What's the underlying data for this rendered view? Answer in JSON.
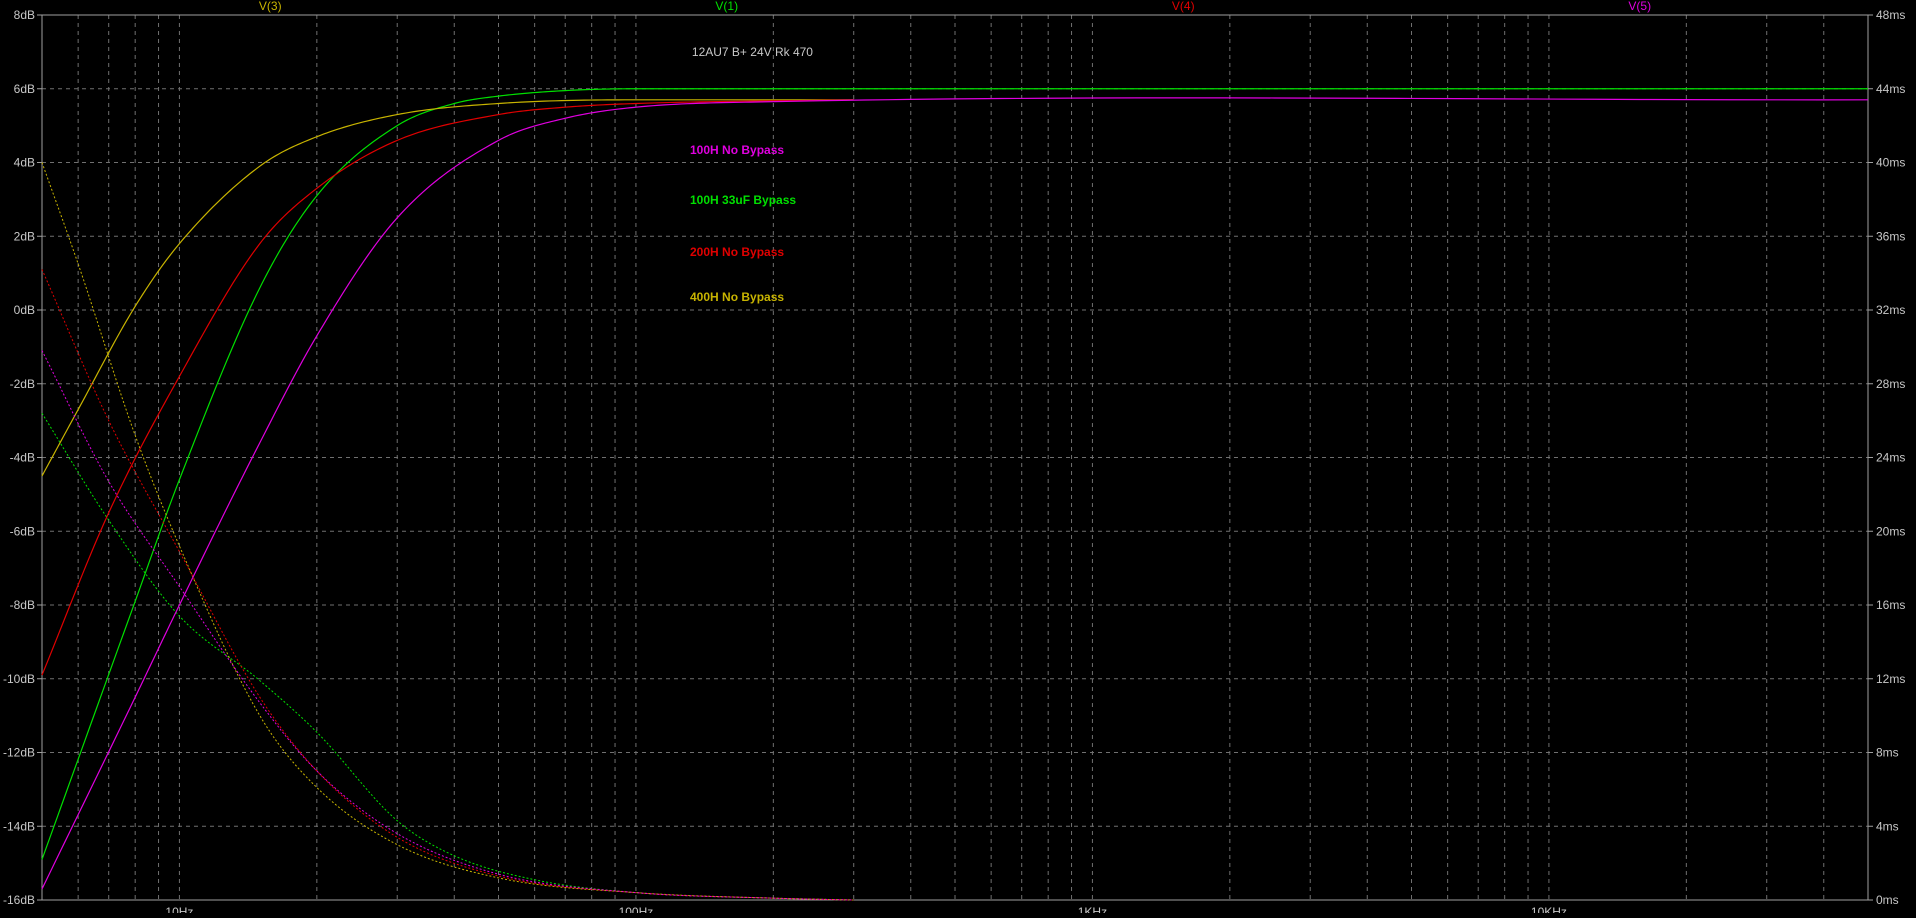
{
  "chart_data": {
    "type": "line",
    "title": "12AU7 B+ 24V Rk 470",
    "x_scale": "log",
    "xlim": [
      5,
      50000
    ],
    "y_left": {
      "unit": "dB",
      "ylim": [
        -16,
        8
      ],
      "ticks": [
        "8dB",
        "6dB",
        "4dB",
        "2dB",
        "0dB",
        "-2dB",
        "-4dB",
        "-6dB",
        "-8dB",
        "-10dB",
        "-12dB",
        "-14dB",
        "-16dB"
      ]
    },
    "y_right": {
      "unit": "ms",
      "ylim": [
        0,
        48
      ],
      "ticks": [
        "48ms",
        "44ms",
        "40ms",
        "36ms",
        "32ms",
        "28ms",
        "24ms",
        "20ms",
        "16ms",
        "12ms",
        "8ms",
        "4ms",
        "0ms"
      ]
    },
    "x_ticks": [
      {
        "value": 10,
        "label": "10Hz"
      },
      {
        "value": 100,
        "label": "100Hz"
      },
      {
        "value": 1000,
        "label": "1KHz"
      },
      {
        "value": 10000,
        "label": "10KHz"
      }
    ],
    "grid": true,
    "trace_headers": [
      {
        "label": "V(3)",
        "color": "#c8b400"
      },
      {
        "label": "V(1)",
        "color": "#00e000"
      },
      {
        "label": "V(4)",
        "color": "#e00000"
      },
      {
        "label": "V(5)",
        "color": "#e000e0"
      }
    ],
    "series": [
      {
        "name": "V(1)",
        "color": "#00e000",
        "magnitude_db": [
          [
            5,
            -14.9
          ],
          [
            8,
            -7.9
          ],
          [
            10,
            -4.6
          ],
          [
            15,
            0.6
          ],
          [
            20,
            3.1
          ],
          [
            30,
            5.0
          ],
          [
            40,
            5.6
          ],
          [
            50,
            5.8
          ],
          [
            70,
            5.95
          ],
          [
            100,
            6.0
          ],
          [
            300,
            6.0
          ],
          [
            50000,
            6.0
          ]
        ],
        "group_delay_ms": [
          [
            5,
            26.4
          ],
          [
            7,
            20.6
          ],
          [
            10,
            15.4
          ],
          [
            15,
            11.9
          ],
          [
            20,
            9.1
          ],
          [
            30,
            4.3
          ],
          [
            40,
            2.4
          ],
          [
            60,
            1.1
          ],
          [
            100,
            0.4
          ],
          [
            200,
            0.1
          ],
          [
            300,
            0.0
          ]
        ]
      },
      {
        "name": "V(3)",
        "color": "#c8b400",
        "magnitude_db": [
          [
            5,
            -4.5
          ],
          [
            6,
            -2.7
          ],
          [
            8,
            0.1
          ],
          [
            10,
            1.8
          ],
          [
            15,
            3.9
          ],
          [
            20,
            4.7
          ],
          [
            30,
            5.3
          ],
          [
            50,
            5.6
          ],
          [
            100,
            5.7
          ],
          [
            300,
            5.7
          ]
        ],
        "group_delay_ms": [
          [
            5,
            40.0
          ],
          [
            6,
            34.5
          ],
          [
            8,
            25.2
          ],
          [
            10,
            19.2
          ],
          [
            15,
            10.0
          ],
          [
            20,
            6.1
          ],
          [
            30,
            3.0
          ],
          [
            50,
            1.2
          ],
          [
            100,
            0.4
          ],
          [
            200,
            0.1
          ],
          [
            300,
            0.0
          ]
        ]
      },
      {
        "name": "V(4)",
        "color": "#e00000",
        "magnitude_db": [
          [
            5,
            -9.9
          ],
          [
            7,
            -5.5
          ],
          [
            10,
            -1.8
          ],
          [
            15,
            1.8
          ],
          [
            20,
            3.3
          ],
          [
            30,
            4.6
          ],
          [
            50,
            5.3
          ],
          [
            70,
            5.5
          ],
          [
            100,
            5.6
          ],
          [
            300,
            5.7
          ]
        ],
        "group_delay_ms": [
          [
            5,
            34.2
          ],
          [
            7,
            26.0
          ],
          [
            10,
            18.9
          ],
          [
            15,
            11.0
          ],
          [
            20,
            7.0
          ],
          [
            30,
            3.4
          ],
          [
            50,
            1.3
          ],
          [
            100,
            0.4
          ],
          [
            200,
            0.1
          ],
          [
            300,
            0.0
          ]
        ]
      },
      {
        "name": "V(5)",
        "color": "#e000e0",
        "magnitude_db": [
          [
            5,
            -15.7
          ],
          [
            8,
            -10.5
          ],
          [
            10,
            -8.0
          ],
          [
            15,
            -3.6
          ],
          [
            20,
            -0.7
          ],
          [
            30,
            2.5
          ],
          [
            50,
            4.6
          ],
          [
            70,
            5.2
          ],
          [
            100,
            5.5
          ],
          [
            200,
            5.65
          ],
          [
            50000,
            5.7
          ]
        ],
        "group_delay_ms": [
          [
            5,
            29.8
          ],
          [
            7,
            22.7
          ],
          [
            10,
            17.0
          ],
          [
            15,
            10.7
          ],
          [
            20,
            7.0
          ],
          [
            30,
            3.6
          ],
          [
            50,
            1.4
          ],
          [
            100,
            0.4
          ],
          [
            200,
            0.1
          ],
          [
            300,
            0.0
          ]
        ]
      }
    ],
    "annotations": [
      {
        "text": "100H No Bypass",
        "color": "#e000e0"
      },
      {
        "text": "100H 33uF Bypass",
        "color": "#00e000"
      },
      {
        "text": "200H No Bypass",
        "color": "#e00000"
      },
      {
        "text": "400H No Bypass",
        "color": "#c8b400"
      }
    ],
    "colors": {
      "background": "#000000",
      "frame": "#a0a0a0",
      "grid": "#707070",
      "tick_text": "#c8c8c8",
      "title_text": "#c8c8c8"
    }
  }
}
